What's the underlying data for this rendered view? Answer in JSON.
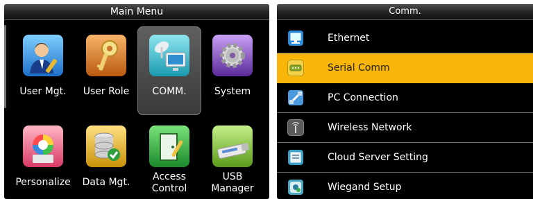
{
  "main_menu": {
    "title": "Main Menu",
    "items": [
      {
        "label": "User Mgt.",
        "icon": "user-mgt-icon"
      },
      {
        "label": "User Role",
        "icon": "key-icon"
      },
      {
        "label": "COMM.",
        "icon": "comm-icon",
        "selected": true
      },
      {
        "label": "System",
        "icon": "gear-icon"
      },
      {
        "label": "Personalize",
        "icon": "personalize-icon"
      },
      {
        "label": "Data Mgt.",
        "icon": "database-icon"
      },
      {
        "label_line1": "Access",
        "label_line2": "Control",
        "icon": "door-icon"
      },
      {
        "label_line1": "USB",
        "label_line2": "Manager",
        "icon": "usb-icon"
      }
    ]
  },
  "comm_menu": {
    "title": "Comm.",
    "items": [
      {
        "label": "Ethernet",
        "icon": "ethernet-icon"
      },
      {
        "label": "Serial Comm",
        "icon": "serial-port-icon",
        "selected": true
      },
      {
        "label": "PC Connection",
        "icon": "pc-connection-icon"
      },
      {
        "label": "Wireless Network",
        "icon": "wireless-icon"
      },
      {
        "label": "Cloud Server Setting",
        "icon": "cloud-server-icon"
      },
      {
        "label": "Wiegand Setup",
        "icon": "wiegand-icon"
      }
    ]
  },
  "colors": {
    "highlight": "#f8b50a",
    "background": "#000000"
  }
}
